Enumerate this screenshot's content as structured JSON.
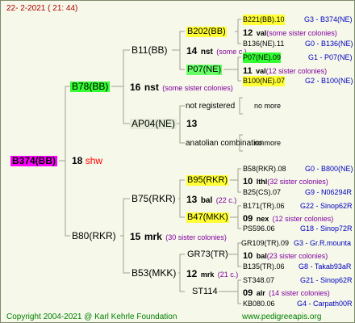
{
  "header_date": "22-  2-2021 ( 21: 44)",
  "footer": {
    "copyright": "Copyright 2004-2021 @ Karl Kehrle Foundation",
    "site": "www.pedigreeapis.org"
  },
  "root": {
    "name": "B374(BB)",
    "gen_num": "18",
    "gen_code": "shw"
  },
  "sire": {
    "name": "B78(BB)",
    "gen_num": "16",
    "gen_code": "nst",
    "sisters": "(some sister colonies)"
  },
  "dam": {
    "name": "B80(RKR)",
    "gen_num": "15",
    "gen_code": "mrk",
    "sisters": "(30 sister colonies)"
  },
  "sire_sire": {
    "name": "B11(BB)",
    "gen_num": "14",
    "gen_code": "nst",
    "sisters": "(some c.)"
  },
  "sire_dam": {
    "name": "AP04(NE)",
    "gen_num": "13"
  },
  "dam_sire": {
    "name": "B75(RKR)",
    "gen_num": "13",
    "gen_code": "bal",
    "sisters": "(22 c.)"
  },
  "dam_dam": {
    "name": "B53(MKK)",
    "gen_num": "12",
    "gen_code": "mrk",
    "sisters": "(21 c.)"
  },
  "g3": [
    {
      "name": "B202(BB)",
      "gen_num": "12",
      "gen_code": "val",
      "sisters": "(some sister colonies)"
    },
    {
      "name": "P07(NE)",
      "gen_num": "11",
      "gen_code": "val",
      "sisters": "(12 sister colonies)"
    },
    {
      "name": "not registered"
    },
    {
      "name": "anatolian combination"
    },
    {
      "name": "B95(RKR)",
      "gen_num": "10",
      "gen_code": "lthl",
      "sisters": "(32 sister colonies)"
    },
    {
      "name": "B47(MKK)",
      "gen_num": "09",
      "gen_code": "nex",
      "sisters": "(12 sister colonies)"
    },
    {
      "name": "GR73(TR)",
      "gen_num": "10",
      "gen_code": "bal",
      "sisters": "(23 sister colonies)"
    },
    {
      "name": "ST114",
      "gen_num": "09",
      "gen_code": "alr",
      "sisters": "(14 sister colonies)"
    }
  ],
  "g4": [
    {
      "name": "B221(BB).10",
      "line": "G3 - B374(NE)"
    },
    {
      "name": "B136(NE).11",
      "line": "G0 - B136(NE)"
    },
    {
      "name": "P07(NE).09",
      "line": "G1 - P07(NE)"
    },
    {
      "name": "B100(NE).07",
      "line": "G2 - B100(NE)"
    },
    {
      "name": "no more"
    },
    {
      "name": "no more"
    },
    {
      "name": "B58(RKR).08",
      "line": "G0 - B800(NE)"
    },
    {
      "name": "B25(CS).07",
      "line": "G9 - N06294R"
    },
    {
      "name": "B171(TR).06",
      "line": "G22 - Sinop62R"
    },
    {
      "name": "PS596.06",
      "line": "G18 - Sinop72R"
    },
    {
      "name": "GR109(TR).09",
      "line": "G3 - Gr.R.mounta"
    },
    {
      "name": "B135(TR).06",
      "line": "G8 - Takab93aR"
    },
    {
      "name": "ST348.07",
      "line": "G21 - Sinop62R"
    },
    {
      "name": "KB080.06",
      "line": "G4 - Carpath00R"
    }
  ],
  "colors": {
    "background": "#f6f8ea",
    "line": "#a0a090",
    "generation_code": "#ff0000",
    "sister_text": "#8000a0",
    "breeding_line": "#0000c0",
    "highlight_root": "#ff00ff",
    "highlight_sire": "#33ff33",
    "highlight_yellow": "#ffff33"
  }
}
